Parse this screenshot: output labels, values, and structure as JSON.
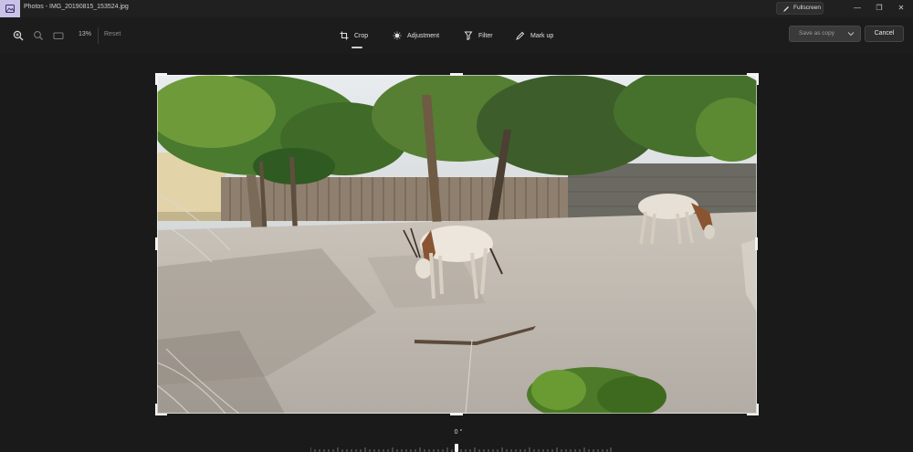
{
  "window": {
    "title": "Photos - IMG_20190815_153524.jpg",
    "fullscreen_label": "Fullscreen",
    "minimize_glyph": "—",
    "restore_glyph": "❐",
    "close_glyph": "✕"
  },
  "toolbar": {
    "zoom_value": "13%",
    "reset_label": "Reset",
    "tabs": [
      {
        "label": "Crop",
        "icon": "crop-icon",
        "active": true
      },
      {
        "label": "Adjustment",
        "icon": "brightness-icon",
        "active": false
      },
      {
        "label": "Filter",
        "icon": "filter-icon",
        "active": false
      },
      {
        "label": "Mark up",
        "icon": "pen-icon",
        "active": false
      }
    ],
    "save_label": "Save as copy",
    "cancel_label": "Cancel"
  },
  "editor": {
    "straighten_angle": "0 °",
    "photo_subject": "Two white oryx grazing in a sandy zoo enclosure with trees and a wooden fence"
  },
  "colors": {
    "background": "#1c1c1c",
    "app_icon": "#c9c2e6",
    "handle": "#f2f2f2"
  }
}
